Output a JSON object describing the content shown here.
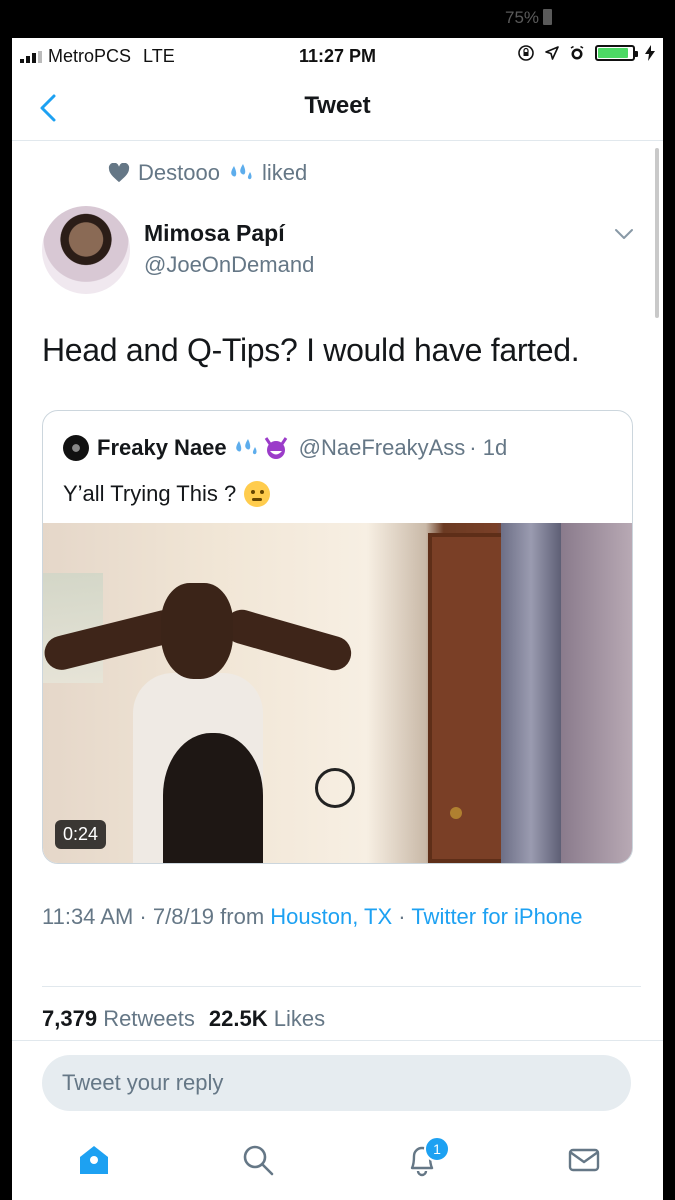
{
  "outer": {
    "battery_percent": "75%"
  },
  "status_bar": {
    "carrier": "MetroPCS",
    "network": "LTE",
    "time": "11:27 PM"
  },
  "nav": {
    "title": "Tweet",
    "back_icon": "chevron-left-icon"
  },
  "social_context": {
    "user": "Destooo",
    "action": "liked"
  },
  "tweet": {
    "author_name": "Mimosa Papí",
    "author_handle": "@JoeOnDemand",
    "text": "Head and Q-Tips? I would have farted.",
    "timestamp": "11:34 AM · 7/8/19 from",
    "location": "Houston, TX",
    "separator": " · ",
    "source": "Twitter for iPhone"
  },
  "quoted_tweet": {
    "author_name": "Freaky Naee",
    "author_handle": "@NaeFreakyAss",
    "age": "· 1d",
    "text": "Y’all Trying This ?",
    "video_duration": "0:24"
  },
  "stats": {
    "retweets_count": "7,379",
    "retweets_label": "Retweets",
    "likes_count": "22.5K",
    "likes_label": "Likes"
  },
  "reply": {
    "placeholder": "Tweet your reply"
  },
  "tabbar": {
    "notifications_badge": "1",
    "icons": [
      "home-icon",
      "search-icon",
      "notifications-icon",
      "messages-icon"
    ]
  },
  "colors": {
    "accent": "#1da1f2",
    "secondary_text": "#657786",
    "primary_text": "#14171a",
    "divider": "#e1e8ed"
  }
}
